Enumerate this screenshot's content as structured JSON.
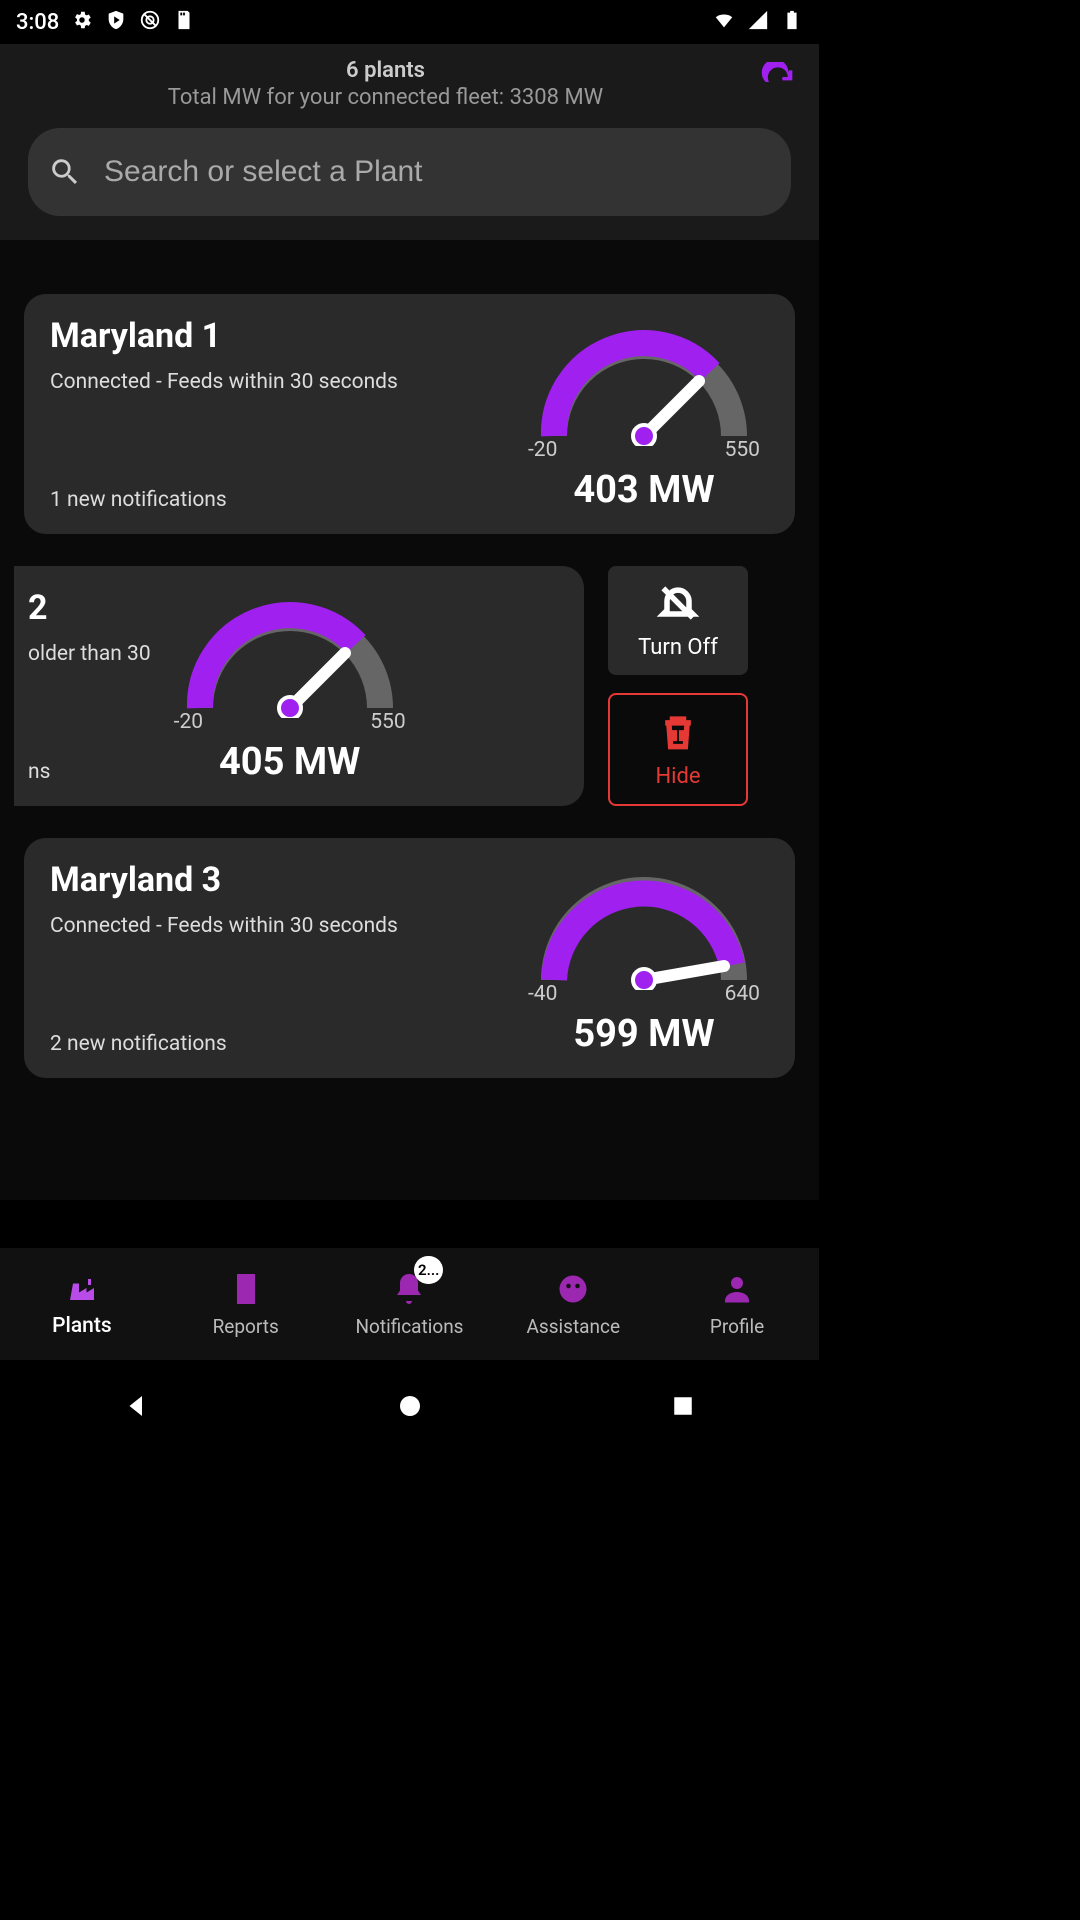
{
  "statusbar": {
    "time": "3:08"
  },
  "header": {
    "plants_count": "6 plants",
    "fleet_total": "Total MW for your connected fleet: 3308 MW"
  },
  "search": {
    "placeholder": "Search or select a Plant"
  },
  "plants": [
    {
      "name": "Maryland 1",
      "status": "Connected - Feeds within 30 seconds",
      "notifications": "1 new notifications",
      "gauge": {
        "min": "-20",
        "max": "550",
        "value": "403 MW",
        "fill_pct": 74,
        "needle_deg": 45
      }
    },
    {
      "name": "2",
      "status": "older than 30",
      "notifications": "ns",
      "gauge": {
        "min": "-20",
        "max": "550",
        "value": "405 MW",
        "fill_pct": 74,
        "needle_deg": 45
      }
    },
    {
      "name": "Maryland 3",
      "status": "Connected - Feeds within 30 seconds",
      "notifications": "2 new notifications",
      "gauge": {
        "min": "-40",
        "max": "640",
        "value": "599 MW",
        "fill_pct": 94,
        "needle_deg": 80
      }
    }
  ],
  "swipe_actions": {
    "turn_off": "Turn Off",
    "hide": "Hide"
  },
  "nav": {
    "items": [
      {
        "label": "Plants"
      },
      {
        "label": "Reports"
      },
      {
        "label": "Notifications",
        "badge": "2..."
      },
      {
        "label": "Assistance"
      },
      {
        "label": "Profile"
      }
    ]
  },
  "colors": {
    "accent": "#a020f0",
    "danger": "#e53935"
  }
}
